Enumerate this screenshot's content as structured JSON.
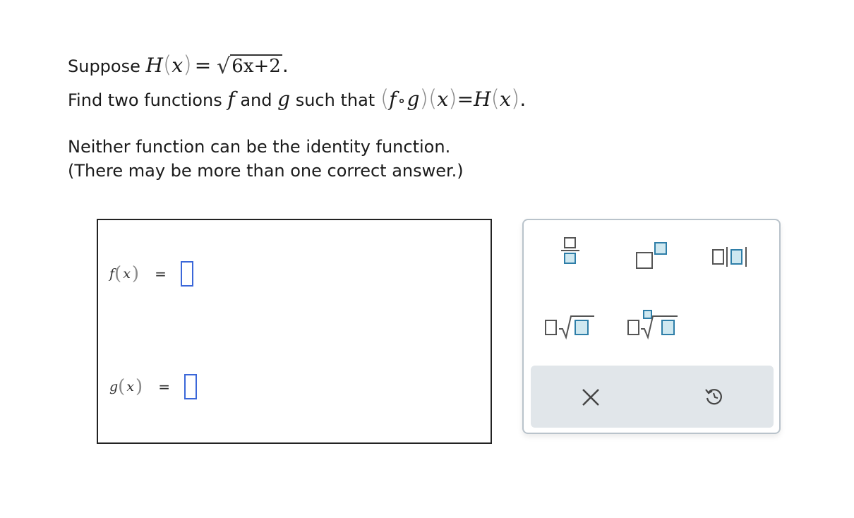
{
  "problem": {
    "line1_prefix": "Suppose ",
    "H_name": "H",
    "x_var": "x",
    "equals": "=",
    "radicand": "6x+2",
    "line1_end": ".",
    "line2_prefix": "Find two functions ",
    "f_name": "f",
    "and_text": " and ",
    "g_name": "g",
    "such_that": " such that ",
    "compose_op": "∘",
    "line2_end": ".",
    "note1": "Neither function can be the identity function.",
    "note2": "(There may be more than one correct answer.)"
  },
  "answers": {
    "f_label": "f",
    "g_label": "g",
    "var": "x",
    "equals": "=",
    "f_value": "",
    "g_value": ""
  },
  "palette": {
    "tools": [
      "fraction-tool",
      "exponent-tool",
      "absolute-value-tool",
      "sqrt-tool",
      "nth-root-tool"
    ],
    "clear_symbol": "×",
    "undo_symbol": "↺",
    "accent_color": "#2e7ea8",
    "highlight_fill": "#cfe8f0",
    "input_border_color": "#3b67d9"
  }
}
